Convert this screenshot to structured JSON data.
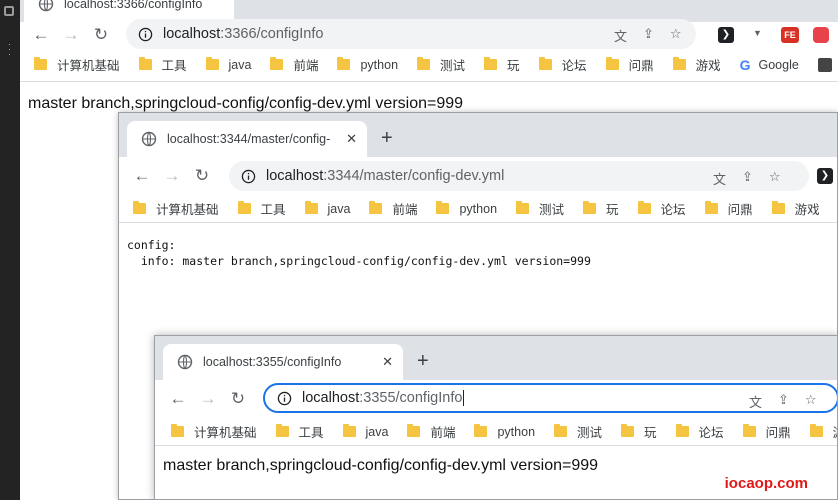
{
  "window1": {
    "tab_title": "localhost:3366/configInfo",
    "url_host": "localhost",
    "url_path": ":3366/configInfo",
    "page_text": "master branch,springcloud-config/config-dev.yml version=999",
    "ext_fe_label": "FE",
    "bookmark_tail": "赖卓"
  },
  "window2": {
    "tab_title": "localhost:3344/master/config-",
    "url_host": "localhost",
    "url_path": ":3344/master/config-dev.yml",
    "yaml_line1": "config:",
    "yaml_line2": "  info: master branch,springcloud-config/config-dev.yml version=999"
  },
  "window3": {
    "tab_title": "localhost:3355/configInfo",
    "url_host": "localhost",
    "url_path": ":3355/configInfo",
    "page_text": "master branch,springcloud-config/config-dev.yml version=999"
  },
  "bookmarks": [
    "计算机基础",
    "工具",
    "java",
    "前端",
    "python",
    "测试",
    "玩",
    "论坛",
    "问鼎",
    "游戏"
  ],
  "google_label": "Google",
  "watermark": "iocaop.com",
  "icons": {
    "back": "arrow-left-icon",
    "forward": "arrow-right-icon",
    "reload": "reload-icon",
    "site_info": "info-circle-icon",
    "translate": "translate-icon",
    "share": "share-icon",
    "bookmark_star": "star-icon",
    "tab_favicon": "globe-icon",
    "new_tab": "plus-icon",
    "close_tab": "close-icon"
  },
  "colors": {
    "tab_strip": "#dee1e6",
    "focus_ring": "#1a73e8",
    "folder": "#f5c542",
    "watermark": "#e01818"
  }
}
